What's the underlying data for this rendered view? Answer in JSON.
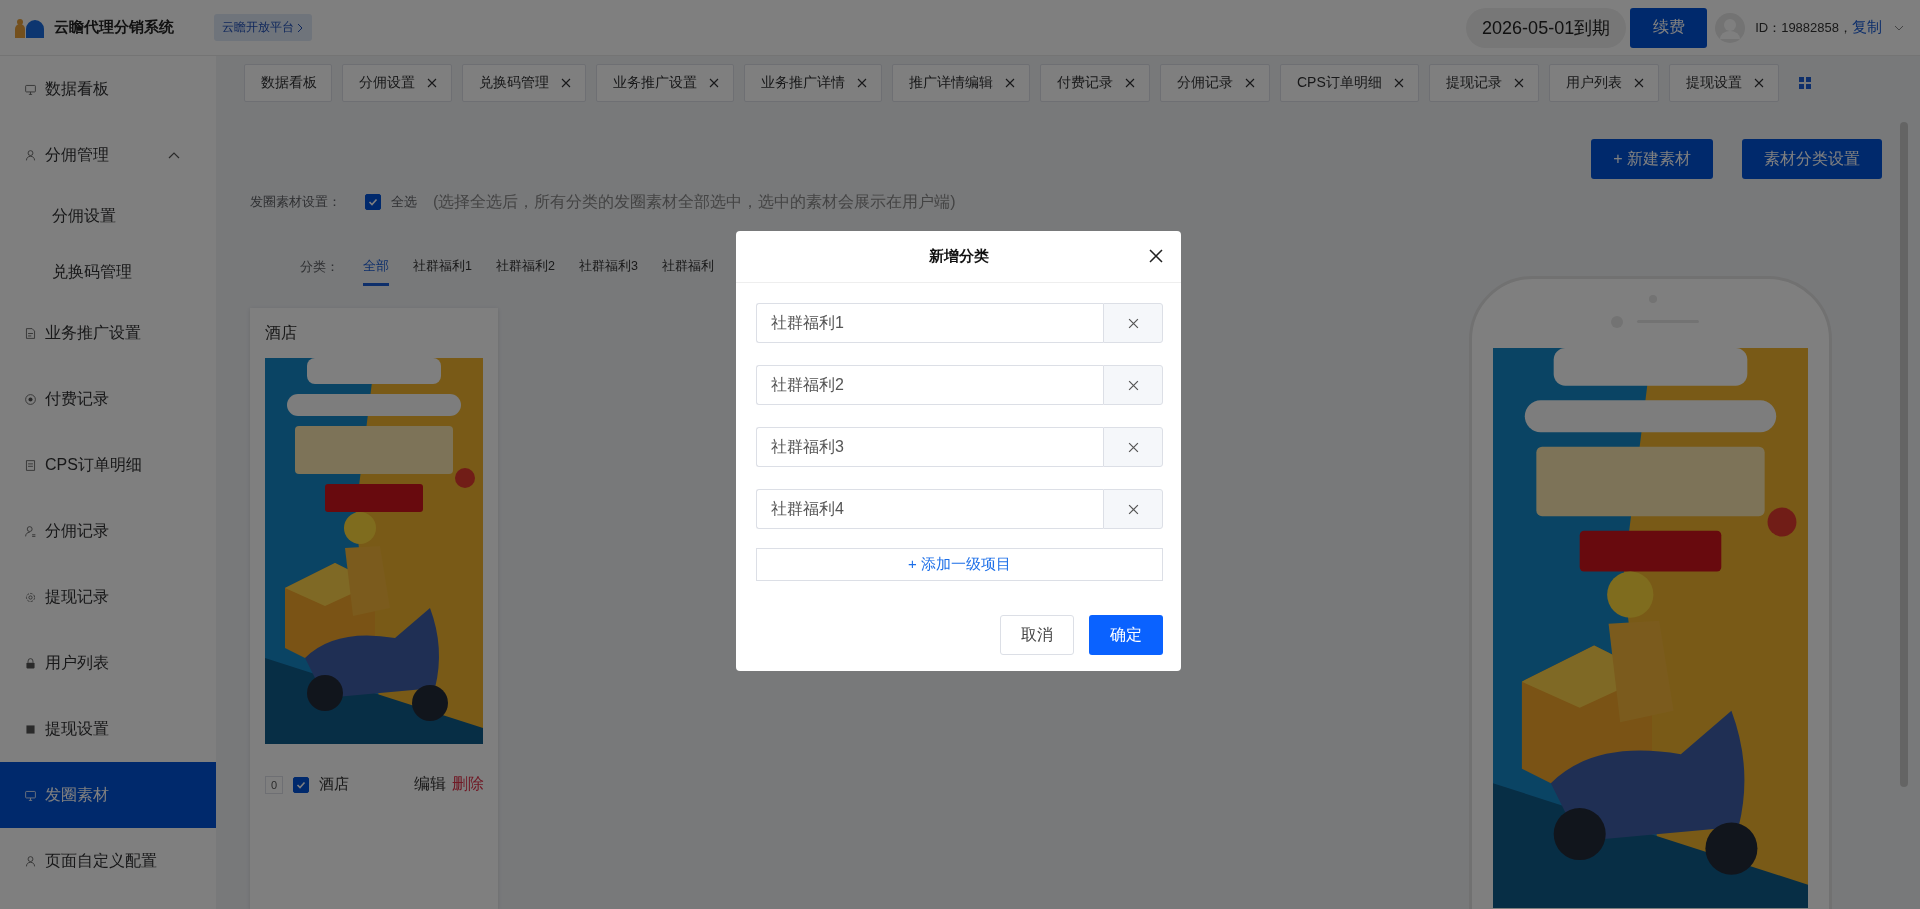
{
  "header": {
    "title": "云瞻代理分销系统",
    "platform_link": "云瞻开放平台",
    "expiry": "2026-05-01到期",
    "renew_button": "续费",
    "user_id": "ID：19882858，",
    "copy_link": "复制"
  },
  "sidebar": {
    "items": [
      {
        "label": "数据看板",
        "selected": false
      },
      {
        "label": "分佣管理",
        "selected": false,
        "expanded": true,
        "children": [
          {
            "label": "分佣设置",
            "selected": false
          },
          {
            "label": "兑换码管理",
            "selected": false
          }
        ]
      },
      {
        "label": "业务推广设置",
        "selected": false
      },
      {
        "label": "付费记录",
        "selected": false
      },
      {
        "label": "CPS订单明细",
        "selected": false
      },
      {
        "label": "分佣记录",
        "selected": false
      },
      {
        "label": "提现记录",
        "selected": false
      },
      {
        "label": "用户列表",
        "selected": false
      },
      {
        "label": "提现设置",
        "selected": false
      },
      {
        "label": "发圈素材",
        "selected": true
      },
      {
        "label": "页面自定义配置",
        "selected": false
      }
    ]
  },
  "tabs": [
    {
      "label": "数据看板",
      "closable": false
    },
    {
      "label": "分佣设置",
      "closable": true
    },
    {
      "label": "兑换码管理",
      "closable": true
    },
    {
      "label": "业务推广设置",
      "closable": true
    },
    {
      "label": "业务推广详情",
      "closable": true
    },
    {
      "label": "推广详情编辑",
      "closable": true
    },
    {
      "label": "付费记录",
      "closable": true
    },
    {
      "label": "分佣记录",
      "closable": true
    },
    {
      "label": "CPS订单明细",
      "closable": true
    },
    {
      "label": "提现记录",
      "closable": true
    },
    {
      "label": "用户列表",
      "closable": true
    },
    {
      "label": "提现设置",
      "closable": true
    }
  ],
  "toolbar_buttons": [
    "+ 新建素材",
    "素材分类设置"
  ],
  "settings": {
    "label": "发圈素材设置：",
    "select_all": {
      "label": "全选",
      "checked": true
    },
    "hint": "(选择全选后，所有分类的发圈素材全部选中，选中的素材会展示在用户端)"
  },
  "categories": {
    "label": "分类：",
    "items": [
      {
        "label": "全部",
        "selected": true
      },
      {
        "label": "社群福利1",
        "selected": false
      },
      {
        "label": "社群福利2",
        "selected": false
      },
      {
        "label": "社群福利3",
        "selected": false
      },
      {
        "label": "社群福利",
        "selected": false
      }
    ]
  },
  "cards": [
    {
      "title": "酒店",
      "sort": "0",
      "checked": true,
      "name": "酒店",
      "edit": "编辑",
      "delete": "删除"
    }
  ],
  "modal": {
    "title": "新增分类",
    "items": [
      {
        "value": "社群福利1"
      },
      {
        "value": "社群福利2"
      },
      {
        "value": "社群福利3"
      },
      {
        "value": "社群福利4"
      }
    ],
    "add_button": "+ 添加一级项目",
    "cancel_button": "取消",
    "confirm_button": "确定"
  }
}
